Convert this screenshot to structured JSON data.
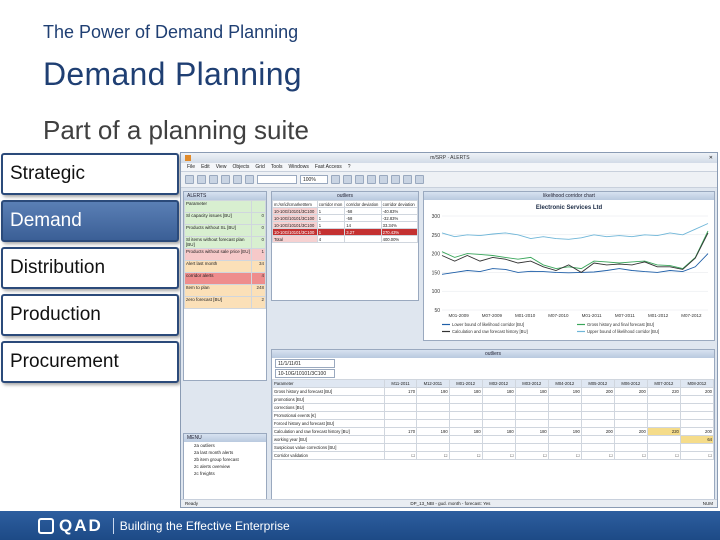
{
  "slide": {
    "kicker": "The Power of Demand Planning",
    "title": "Demand Planning",
    "subtitle": "Part of a planning suite"
  },
  "suite": {
    "items": [
      {
        "label": "Strategic",
        "active": false
      },
      {
        "label": "Demand",
        "active": true
      },
      {
        "label": "Distribution",
        "active": false
      },
      {
        "label": "Production",
        "active": false
      },
      {
        "label": "Procurement",
        "active": false
      }
    ]
  },
  "app": {
    "window_title": "m/SRP · ALERTS",
    "menu": [
      "File",
      "Edit",
      "View",
      "Objects",
      "Grid",
      "Tools",
      "Windows",
      "Fast Access",
      "?"
    ],
    "zoom": "100%",
    "alerts": {
      "title": "ALERTS",
      "rows": [
        {
          "label": "Parameter",
          "value": "",
          "color": "g"
        },
        {
          "label": "Sl capacity issues [BU]",
          "value": "0",
          "color": "g"
        },
        {
          "label": "Products without SL [BU]",
          "value": "0",
          "color": "g"
        },
        {
          "label": "Sl items without forecast plan [BU]",
          "value": "0",
          "color": "g"
        },
        {
          "label": "Products without sale price [EU]",
          "value": "1",
          "color": "r"
        },
        {
          "label": "Alert last month",
          "value": "34",
          "color": "o"
        },
        {
          "label": "corridor alerts",
          "value": "4",
          "color": "rr"
        },
        {
          "label": "Item to plan",
          "value": "248",
          "color": "o"
        },
        {
          "label": "zero forecast [BU]",
          "value": "2",
          "color": "o"
        }
      ]
    },
    "menu_panel": {
      "title": "MENU",
      "items": [
        "2a outliers",
        "2a last month alerts",
        "2b item group forecast",
        "2c alerts overview",
        "2c freights"
      ]
    },
    "outliers": {
      "title": "outliers",
      "headers": [
        "m:/sr/id/cmarketItem",
        "corridor mon",
        "corridor deviation",
        "corridor deviation"
      ],
      "rows": [
        {
          "cells": [
            "10-10G/10101/3C100",
            "1",
            "-58",
            "-40.83%"
          ],
          "sel": false
        },
        {
          "cells": [
            "10-10G/10101/3C100",
            "1",
            "-58",
            "-32.83%"
          ],
          "sel": false
        },
        {
          "cells": [
            "10-10G/10101/3C100",
            "1",
            "14",
            "33.34%"
          ],
          "sel": false
        },
        {
          "cells": [
            "10-10G/10101/3C100",
            "1",
            "3.27",
            "270.43%"
          ],
          "sel": true
        },
        {
          "cells": [
            "Total",
            "4",
            "",
            "400.00%"
          ],
          "sel": false
        }
      ]
    },
    "chart": {
      "title": "likelihood corridor chart",
      "company": "Electronic Services Ltd"
    },
    "grid": {
      "title": "outliers",
      "filter_a": "11/1/11/01",
      "filter_b": "10-10G/10101/3C100",
      "headers": [
        "Parameter",
        "M11-2011",
        "M12-2011",
        "M01-2012",
        "M02-2012",
        "M03-2012",
        "M04-2012",
        "M05-2012",
        "M06-2012",
        "M07-2012",
        "M08-2012"
      ],
      "rows": [
        {
          "label": "Gross history and forecast [BU]",
          "values": [
            "170",
            "190",
            "180",
            "180",
            "180",
            "190",
            "200",
            "200",
            "220",
            "200"
          ],
          "highlight": []
        },
        {
          "label": "promotions [BU]",
          "values": [
            "",
            "",
            "",
            "",
            "",
            "",
            "",
            "",
            "",
            ""
          ],
          "highlight": []
        },
        {
          "label": "corrections [BU]",
          "values": [
            "",
            "",
            "",
            "",
            "",
            "",
            "",
            "",
            "",
            ""
          ],
          "highlight": []
        },
        {
          "label": "Promotional events [€]",
          "values": [
            "",
            "",
            "",
            "",
            "",
            "",
            "",
            "",
            "",
            ""
          ],
          "highlight": []
        },
        {
          "label": "Forced history and forecast [BU]",
          "values": [
            "",
            "",
            "",
            "",
            "",
            "",
            "",
            "",
            "",
            ""
          ],
          "highlight": []
        },
        {
          "label": "Calculation and raw forecast history [BU]",
          "values": [
            "170",
            "190",
            "180",
            "180",
            "180",
            "190",
            "200",
            "200",
            "220",
            "200"
          ],
          "highlight": [
            8
          ]
        },
        {
          "label": "working year [BU]",
          "values": [
            "",
            "",
            "",
            "",
            "",
            "",
            "",
            "",
            "",
            "64"
          ],
          "highlight": [
            9
          ]
        },
        {
          "label": "Suspicious value corrections [BU]",
          "values": [
            "",
            "",
            "",
            "",
            "",
            "",
            "",
            "",
            "",
            ""
          ],
          "highlight": []
        },
        {
          "label": "Corridor validation",
          "values": [
            "☐",
            "☐",
            "☐",
            "☐",
            "☐",
            "☐",
            "☐",
            "☐",
            "☐",
            "☐"
          ],
          "highlight": []
        }
      ]
    },
    "status": {
      "left": "Ready",
      "right": "DP_13_NBI - gud. month - forecast: Yes",
      "mode": "NUM"
    }
  },
  "chart_data": {
    "type": "line",
    "title": "likelihood corridor chart",
    "subtitle": "Electronic Services Ltd",
    "x_labels": [
      "M01-2009",
      "M07-2009",
      "M01-2010",
      "M07-2010",
      "M01-2011",
      "M07-2011",
      "M01-2012",
      "M07-2012"
    ],
    "ylim": [
      50,
      300
    ],
    "yticks": [
      50,
      100,
      150,
      200,
      250,
      300
    ],
    "series": [
      {
        "name": "Lower bound of likelihood corridor [BU]",
        "color": "#1f5fa8",
        "values": [
          145,
          150,
          155,
          152,
          160,
          158,
          150,
          153,
          152,
          150,
          149,
          150,
          151,
          155,
          160,
          155,
          152,
          150,
          155,
          152,
          165,
          200
        ]
      },
      {
        "name": "Gross history and final forecast [BU]",
        "color": "#3aa65b",
        "values": [
          205,
          190,
          200,
          198,
          195,
          190,
          185,
          190,
          170,
          160,
          165,
          160,
          180,
          178,
          175,
          178,
          180,
          170,
          168,
          160,
          190,
          260
        ]
      },
      {
        "name": "Calculation and raw forecast history [BU]",
        "color": "#333333",
        "values": [
          195,
          180,
          195,
          180,
          190,
          185,
          175,
          180,
          165,
          155,
          170,
          150,
          175,
          170,
          172,
          170,
          178,
          165,
          165,
          158,
          188,
          255
        ]
      },
      {
        "name": "Upper bound of likelihood corridor [BU]",
        "color": "#6fb6d8",
        "values": [
          255,
          245,
          250,
          248,
          252,
          255,
          250,
          240,
          245,
          240,
          238,
          242,
          250,
          245,
          248,
          245,
          250,
          248,
          255,
          250,
          265,
          280
        ]
      }
    ]
  },
  "footer": {
    "brand": "QAD",
    "tagline": "Building the Effective Enterprise"
  }
}
